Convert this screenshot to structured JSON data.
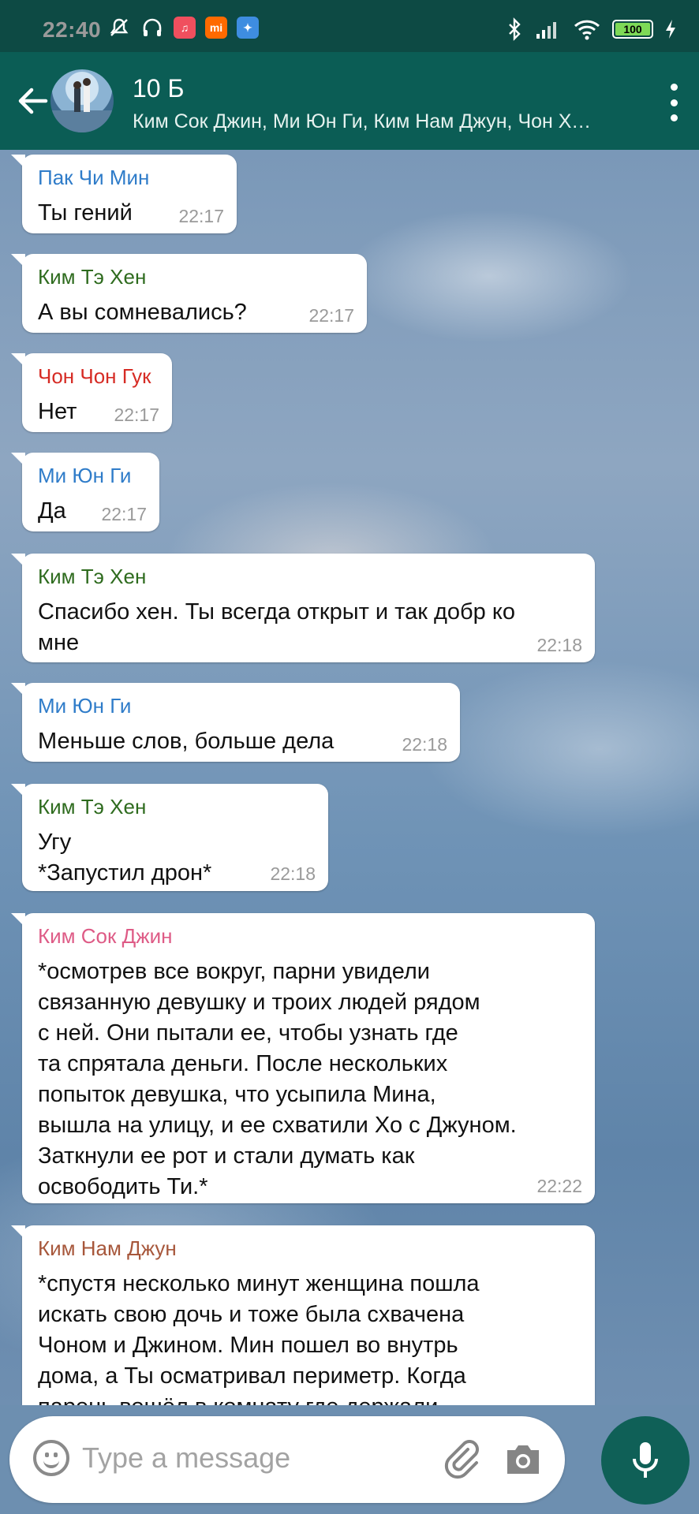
{
  "status_bar": {
    "time": "22:40",
    "battery": "100"
  },
  "chat_header": {
    "title": "10 Б",
    "subtitle": "Ким Сок Джин, Ми Юн Ги, Ким Нам Джун, Чон Хо С.."
  },
  "colors": {
    "header": "#0b5d55",
    "sender_blue": "#2f7cc9",
    "sender_green": "#2e6b1e",
    "sender_red": "#d62b24",
    "sender_pink": "#de5b86",
    "sender_brown": "#a7573b"
  },
  "messages": [
    {
      "sender": "Пак Чи Мин",
      "text": "Ты гений",
      "time": "22:17"
    },
    {
      "sender": "Ким Тэ Хен",
      "text": "А вы сомневались?",
      "time": "22:17"
    },
    {
      "sender": "Чон Чон Гук",
      "text": "Нет",
      "time": "22:17"
    },
    {
      "sender": "Ми Юн Ги",
      "text": "Да",
      "time": "22:17"
    },
    {
      "sender": "Ким Тэ Хен",
      "text": "Спасибо хен. Ты всегда открыт и так добр ко\nмне",
      "time": "22:18"
    },
    {
      "sender": "Ми Юн Ги",
      "text": "Меньше слов, больше дела",
      "time": "22:18"
    },
    {
      "sender": "Ким Тэ Хен",
      "text": "Угу\n*Запустил дрон*",
      "time": "22:18"
    },
    {
      "sender": "Ким Сок Джин",
      "text": "*осмотрев все вокруг, парни увидели\nсвязанную девушку и троих людей рядом\nс ней. Они пытали ее, чтобы узнать где\nта спрятала деньги. После нескольких\nпопыток девушка, что усыпила Мина,\nвышла на улицу, и ее схватили Хо с Джуном.\nЗаткнули ее рот и стали думать как\nосвободить Ти.*",
      "time": "22:22"
    },
    {
      "sender": "Ким Нам Джун",
      "text": "*спустя несколько минут женщина пошла\nискать свою дочь и тоже была схвачена\nЧоном и Джином. Мин пошел во внутрь\nдома, а Ты осматривал периметр. Когда\nпарень вошёл в комнату где держали",
      "time": ""
    }
  ],
  "composer": {
    "placeholder": "Type a message"
  }
}
